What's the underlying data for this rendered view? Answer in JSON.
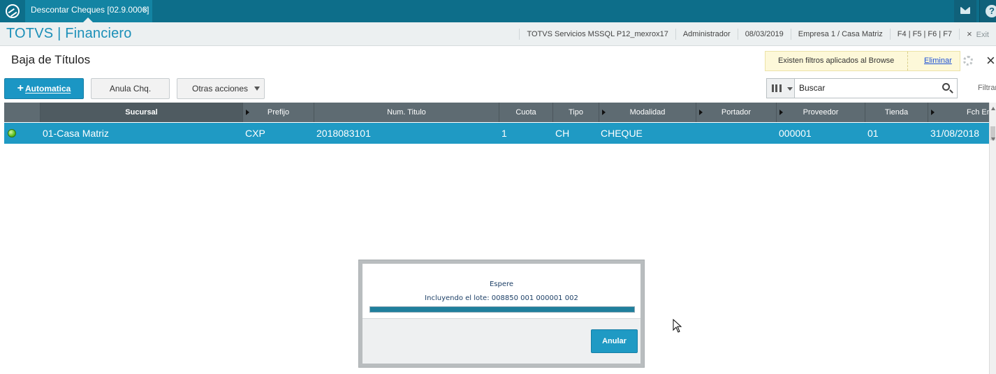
{
  "topbar": {
    "tab_label": "Descontar Cheques [02.9.0006]",
    "tab_close": "×"
  },
  "header": {
    "app_title": "TOTVS | Financiero",
    "server": "TOTVS Servicios MSSQL P12_mexrox17",
    "user": "Administrador",
    "date": "08/03/2019",
    "company": "Empresa 1 / Casa Matriz",
    "shortcuts": "F4 | F5 | F6 | F7",
    "exit_label": "Exit",
    "exit_icon": "×"
  },
  "page": {
    "title": "Baja de Títulos",
    "filter_notice": "Existen filtros aplicados al Browse",
    "filter_remove": "Eliminar",
    "close_icon": "×"
  },
  "toolbar": {
    "primary_plus": "+",
    "primary_label": "Automatica",
    "anula_label": "Anula Chq.",
    "otras_label": "Otras acciones",
    "search_placeholder": "Buscar",
    "filter_label": "Filtrar"
  },
  "grid": {
    "columns": [
      "Sucursal",
      "Prefijo",
      "Num. Titulo",
      "Cuota",
      "Tipo",
      "Modalidad",
      "Portador",
      "Proveedor",
      "Tienda",
      "Fch Em"
    ],
    "rows": [
      {
        "status": "green",
        "sucursal": "01-Casa Matriz",
        "prefijo": "CXP",
        "num_titulo": "2018083101",
        "cuota": "1",
        "tipo": "CH",
        "modalidad": "CHEQUE",
        "portador": "",
        "proveedor": "000001",
        "tienda": "01",
        "fch_emision": "31/08/2018"
      }
    ]
  },
  "modal": {
    "title": "Espere",
    "message": "Incluyendo el lote: 008850 001 000001 002",
    "progress": 1.0,
    "cancel_label": "Anular"
  },
  "colors": {
    "topbar": "#0d6e8a",
    "accent": "#1b96c4",
    "selected_row": "#1f9ac4",
    "grid_header": "#5e6b72"
  }
}
